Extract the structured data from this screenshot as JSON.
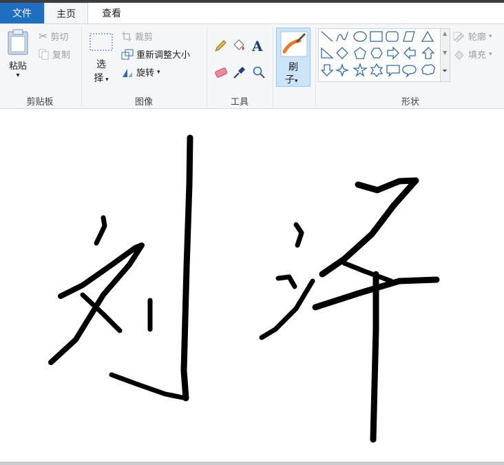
{
  "tabs": {
    "file": "文件",
    "home": "主页",
    "view": "查看"
  },
  "clipboard": {
    "label": "剪贴板",
    "paste_line1": "粘贴",
    "paste_arrow": "▾",
    "cut": "剪切",
    "copy": "复制"
  },
  "image": {
    "label": "图像",
    "select_line1": "选",
    "select_line2": "择",
    "crop": "裁剪",
    "resize": "重新调整大小",
    "rotate": "旋转"
  },
  "tools": {
    "label": "工具"
  },
  "brushes": {
    "line1": "刷",
    "line2": "子"
  },
  "shapes": {
    "label": "形状",
    "outline": "轮廓",
    "fill": "填充"
  },
  "canvas": {
    "handwriting": "刘泽",
    "ink_color": "#000000"
  },
  "colors": {
    "accent": "#1e6fbf",
    "ribbon_bg": "#f5f6f7",
    "selected_bg": "#cce4f7"
  }
}
